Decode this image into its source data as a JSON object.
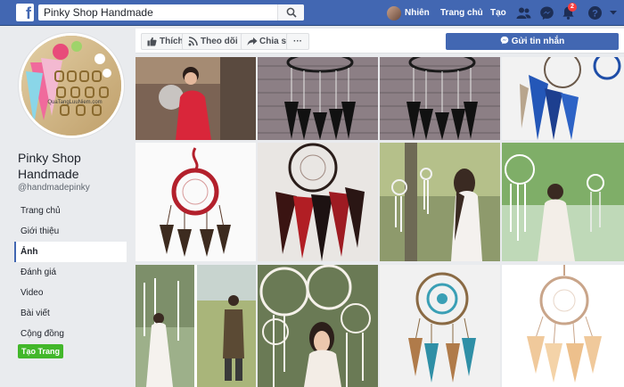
{
  "topbar": {
    "logo": "f",
    "search_value": "Pinky Shop Handmade",
    "user_name": "Nhiên",
    "home_label": "Trang chủ",
    "create_label": "Tạo",
    "notification_count": "2",
    "icons": [
      "search-icon",
      "friend-requests-icon",
      "messenger-icon",
      "notifications-icon",
      "help-icon",
      "dropdown-icon"
    ]
  },
  "page": {
    "name": "Pinky Shop Handmade",
    "handle": "@handmadepinky",
    "watermark": "QuaTangLuuNiem.com"
  },
  "sidebar": {
    "items": [
      {
        "label": "Trang chủ"
      },
      {
        "label": "Giới thiệu"
      },
      {
        "label": "Ảnh"
      },
      {
        "label": "Đánh giá"
      },
      {
        "label": "Video"
      },
      {
        "label": "Bài viết"
      },
      {
        "label": "Cộng đồng"
      }
    ],
    "active_index": 2,
    "create_page_label": "Tạo Trang"
  },
  "actions": {
    "like_label": "Thích",
    "follow_label": "Theo dõi",
    "share_label": "Chia sẻ",
    "more_label": "···",
    "message_label": "Gửi tin nhắn"
  },
  "colors": {
    "brand_blue": "#4267b2",
    "green": "#42b72a",
    "background": "#e9ebee"
  }
}
